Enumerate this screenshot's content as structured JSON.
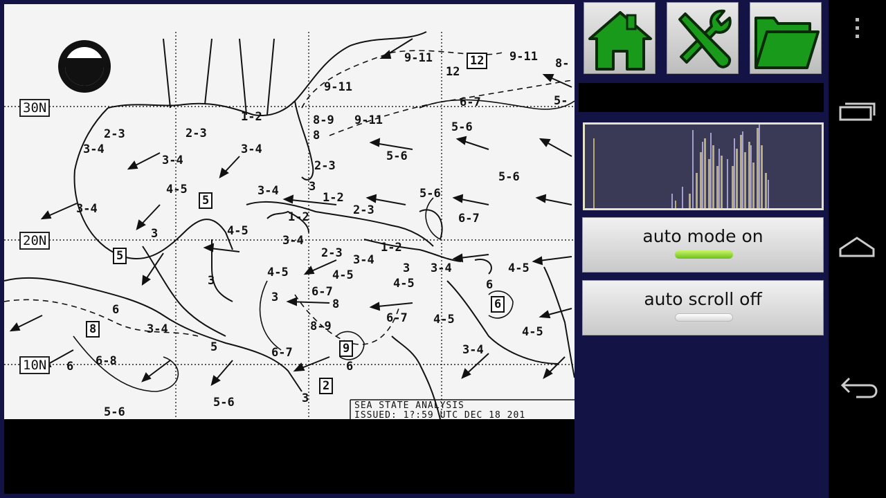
{
  "fax_map": {
    "latitudes": [
      "30N",
      "20N",
      "10N"
    ],
    "box_numbers": [
      "12",
      "5",
      "5",
      "8",
      "9",
      "2",
      "6"
    ],
    "sea_states": [
      "9-11",
      "9-11",
      "12",
      "8-",
      "9-11",
      "8-9",
      "9-11",
      "6-7",
      "5-",
      "2-3",
      "2-3",
      "1-2",
      "3-4",
      "3-4",
      "3-4",
      "5-6",
      "5-6",
      "2-3",
      "5-6",
      "4-5",
      "3-4",
      "1-2",
      "2-3",
      "5-6",
      "3-4",
      "1-2",
      "3-4",
      "6-7",
      "4-5",
      "3",
      "3-4",
      "1-2",
      "2-3",
      "4-5",
      "3-4",
      "4-5",
      "4-5",
      "4-5",
      "3",
      "3",
      "6-7",
      "6",
      "6-7",
      "4-5",
      "4-5",
      "8-9",
      "3-4",
      "6",
      "6-7",
      "6-8",
      "6",
      "5",
      "5-6",
      "5-6",
      "3-4",
      "3",
      "8",
      "6",
      "3",
      "8",
      "3"
    ],
    "footer_line1": "SEA STATE ANALYSIS",
    "footer_line2": "ISSUED: 1?:59 UTC DEC 18 201"
  },
  "toolbar": {
    "home_icon": "home-icon",
    "tools_icon": "tools-icon",
    "folder_icon": "folder-icon",
    "icon_color": "#1a9a1a"
  },
  "controls": {
    "auto_mode_label": "auto mode on",
    "auto_mode_state": "on",
    "auto_scroll_label": "auto scroll off",
    "auto_scroll_state": "off"
  },
  "histogram": {
    "bar_colors": [
      "#b8ac7a",
      "#b6b0e0"
    ],
    "background": "#3a3a56"
  },
  "nav": {
    "menu_icon": "overflow-menu-icon",
    "recents_icon": "recent-apps-icon",
    "home_icon": "android-home-icon",
    "back_icon": "back-icon"
  }
}
